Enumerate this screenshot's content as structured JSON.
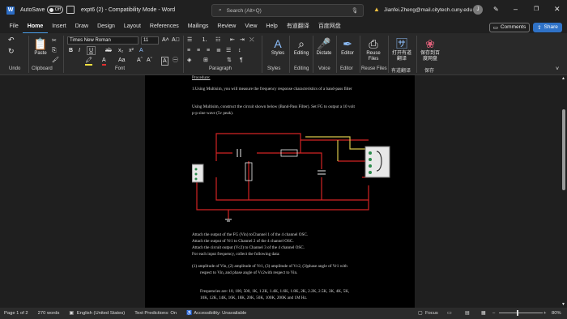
{
  "titlebar": {
    "app_icon": "word-icon",
    "autosave_label": "AutoSave",
    "autosave_state": "Off",
    "doc_title": "expt6 (2)  -  Compatibility Mode  -  Word",
    "search_placeholder": "Search (Alt+Q)",
    "user_email": "Jianfei.Zheng@mail.citytech.cuny.edu"
  },
  "menu": {
    "tabs": [
      "File",
      "Home",
      "Insert",
      "Draw",
      "Design",
      "Layout",
      "References",
      "Mailings",
      "Review",
      "View",
      "Help",
      "有道翻译",
      "百度网盘"
    ],
    "active": "Home",
    "comments": "Comments",
    "share": "Share"
  },
  "ribbon": {
    "font_name": "Times New Roman",
    "font_size": "11",
    "groups": [
      "Undo",
      "Clipboard",
      "Font",
      "Paragraph",
      "Styles",
      "Editing",
      "Voice",
      "Editor",
      "Reuse Files",
      "有道翻译",
      "保存"
    ],
    "paste": "Paste",
    "styles": "Styles",
    "editing": "Editing",
    "dictate": "Dictate",
    "editor": "Editor",
    "reuse_files": "Reuse Files",
    "translate": "打开有道翻译",
    "save_baidu": "保存到百度网盘",
    "accent": "#4a9ee8"
  },
  "document": {
    "heading": "Procedure:",
    "step1": "1.Using Multisim, you will measure the frequency response characteristics of a band-pass filter",
    "construct1": "Using Multisim, construct the circuit shown below (Band-Pass Filter). Set FG to output a 10 volt",
    "construct2": "p-p sine wave (5v peak).",
    "attach1": "Attach the output of the FG (Vin) toChannel 1 of the 4 channel OSC.",
    "attach2": "Attach the output of Vr1 to Channel 2 of the 4 channel OSC.",
    "attach3": "Attach the circuit output (Vc2) to Channel 3 of the 4 channel OSC.",
    "attach4": "For each input frequency, collect the following data:",
    "item1a": "(1)  amplitude of Vin, (2) amplitude of Vr1, (3) amplitude of Vc2, (3)phase angle of Vr1 with",
    "item1b": "respect to Vin, and phase angle of Vc2with respect to Vin.",
    "freq1": "Frequencies are: 10, 100, 500, 1K, 1.2K, 1.4K, 1.6K, 1.8K, 2K, 2.2K, 2.5K, 3K, 4K, 5K,",
    "freq2": "10K, 12K, 14K, 16K, 18K, 20K, 50K, 100K, 200K and 1M Hz."
  },
  "status": {
    "page": "Page 1 of 2",
    "words": "270 words",
    "language": "English (United States)",
    "predictions": "Text Predictions: On",
    "accessibility": "Accessibility: Unavailable",
    "focus": "Focus",
    "zoom": "80%"
  }
}
